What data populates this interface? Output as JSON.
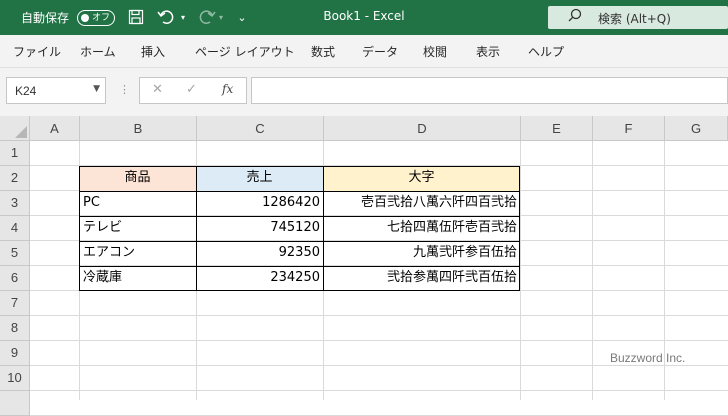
{
  "titlebar": {
    "autosave_label": "自動保存",
    "autosave_state": "オフ",
    "document_title": "Book1  -  Excel",
    "search_placeholder": "検索 (Alt+Q)",
    "background": "#217346"
  },
  "ribbon": {
    "tabs": [
      "ファイル",
      "ホーム",
      "挿入",
      "ページ レイアウト",
      "数式",
      "データ",
      "校閲",
      "表示",
      "ヘルプ"
    ]
  },
  "formula_bar": {
    "name_box": "K24",
    "fx_label": "fx",
    "formula": ""
  },
  "sheet": {
    "columns": [
      "A",
      "B",
      "C",
      "D",
      "E",
      "F",
      "G"
    ],
    "rows": [
      "1",
      "2",
      "3",
      "4",
      "5",
      "6",
      "7",
      "8",
      "9",
      "10"
    ],
    "table": {
      "headers": [
        "商品",
        "売上",
        "大字"
      ],
      "header_colors": [
        "#fce4d6",
        "#ddebf7",
        "#fff2cc"
      ],
      "rows": [
        [
          "PC",
          "1286420",
          "壱百弐拾八萬六阡四百弐拾"
        ],
        [
          "テレビ",
          "745120",
          "七拾四萬伍阡壱百弐拾"
        ],
        [
          "エアコン",
          "92350",
          "九萬弐阡参百伍拾"
        ],
        [
          "冷蔵庫",
          "234250",
          "弐拾参萬四阡弐百伍拾"
        ]
      ]
    }
  },
  "watermark": "Buzzword Inc."
}
